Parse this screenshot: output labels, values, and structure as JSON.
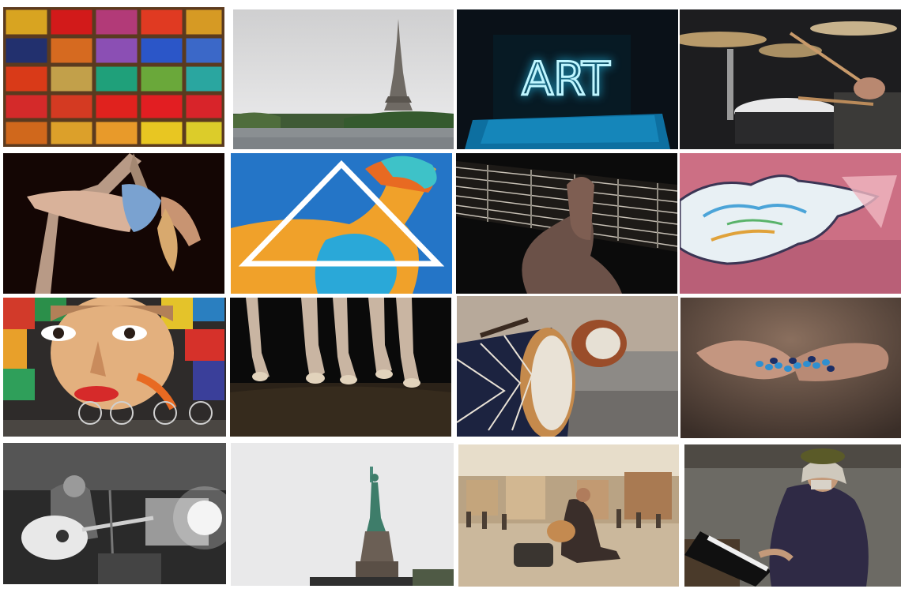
{
  "gallery": {
    "tiles": [
      {
        "id": "pigments",
        "text": ""
      },
      {
        "id": "eiffel-tower",
        "text": ""
      },
      {
        "id": "neon-art-sign",
        "text": "ART"
      },
      {
        "id": "drum-kit",
        "text": ""
      },
      {
        "id": "aerial-silks-dancer",
        "text": ""
      },
      {
        "id": "triangle-mural",
        "text": ""
      },
      {
        "id": "guitar-fretboard",
        "text": ""
      },
      {
        "id": "painted-hand",
        "text": ""
      },
      {
        "id": "graffiti-face-mural",
        "text": ""
      },
      {
        "id": "ballet-feet",
        "text": ""
      },
      {
        "id": "hand-drums",
        "text": ""
      },
      {
        "id": "hands-blue-beads",
        "text": ""
      },
      {
        "id": "guitarist-bw",
        "text": ""
      },
      {
        "id": "statue-of-liberty",
        "text": ""
      },
      {
        "id": "street-guitarist",
        "text": ""
      },
      {
        "id": "old-pianist",
        "text": ""
      }
    ]
  },
  "colors": {
    "background": "#ffffff",
    "neon": "#bff6ff",
    "neon_glow": "#22b8e6"
  }
}
